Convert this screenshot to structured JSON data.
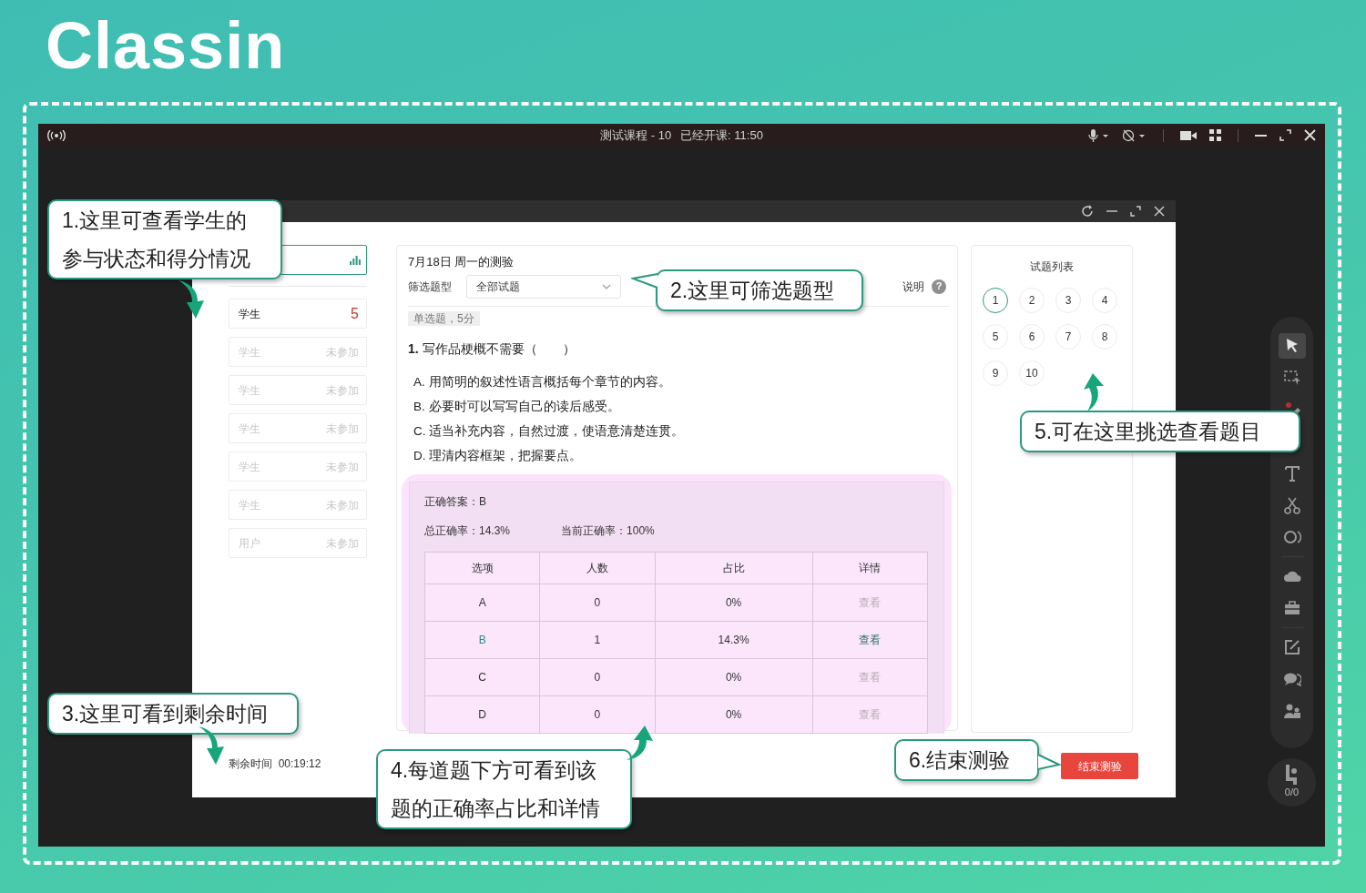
{
  "logo": "Classin",
  "window": {
    "title": "测试课程 - 10",
    "elapsed": "已经开课: 11:50"
  },
  "students": [
    {
      "name": "学生",
      "result": "5",
      "participated": true
    },
    {
      "name": "学生",
      "result": "未参加",
      "participated": false
    },
    {
      "name": "学生",
      "result": "未参加",
      "participated": false
    },
    {
      "name": "学生",
      "result": "未参加",
      "participated": false
    },
    {
      "name": "学生",
      "result": "未参加",
      "participated": false
    },
    {
      "name": "学生",
      "result": "未参加",
      "participated": false
    },
    {
      "name": "用户",
      "result": "未参加",
      "participated": false
    }
  ],
  "remaining_time": {
    "label": "剩余时间",
    "value": "00:19:12"
  },
  "quiz": {
    "title": "7月18日 周一的测验",
    "filter_label": "筛选题型",
    "filter_value": "全部试题",
    "help_label": "说明",
    "help_icon": "?",
    "question_type": "单选题，5分",
    "question": "**1.** 写作品梗概不需要（　　）",
    "options": [
      "A. 用简明的叙述性语言概括每个章节的内容。",
      "B. 必要时可以写写自己的读后感受。",
      "C. 适当补充内容，自然过渡，使语意清楚连贯。",
      "D. 理清内容框架，把握要点。"
    ],
    "correct_answer": "正确答案：B",
    "overall_rate": "总正确率：14.3%",
    "current_rate": "当前正确率：100%",
    "columns": [
      "选项",
      "人数",
      "占比",
      "详情"
    ],
    "rows": [
      {
        "option": "A",
        "count": "0",
        "share": "0%",
        "detail": "查看",
        "correct": false,
        "has_responses": false
      },
      {
        "option": "B",
        "count": "1",
        "share": "14.3%",
        "detail": "查看",
        "correct": true,
        "has_responses": true
      },
      {
        "option": "C",
        "count": "0",
        "share": "0%",
        "detail": "查看",
        "correct": false,
        "has_responses": false
      },
      {
        "option": "D",
        "count": "0",
        "share": "0%",
        "detail": "查看",
        "correct": false,
        "has_responses": false
      }
    ]
  },
  "question_list": {
    "title": "试题列表",
    "items": [
      {
        "label": "1",
        "selected": true
      },
      {
        "label": "2",
        "selected": false
      },
      {
        "label": "3",
        "selected": false
      },
      {
        "label": "4",
        "selected": false
      },
      {
        "label": "5",
        "selected": false
      },
      {
        "label": "6",
        "selected": false
      },
      {
        "label": "7",
        "selected": false
      },
      {
        "label": "8",
        "selected": false
      },
      {
        "label": "9",
        "selected": false
      },
      {
        "label": "10",
        "selected": false
      }
    ]
  },
  "end_button": "结束测验",
  "toolbar": [
    {
      "selected": true
    },
    {
      "selected": false
    },
    {
      "selected": false
    },
    {
      "selected": false
    },
    {
      "selected": false
    },
    {
      "selected": false
    },
    {
      "selected": false
    },
    {
      "selected": false
    },
    {
      "selected": false
    },
    {
      "selected": false
    },
    {
      "selected": false
    }
  ],
  "seat_counter": "0/0",
  "callouts": [
    {
      "lines": [
        "1.这里可查看学生的",
        "参与状态和得分情况"
      ]
    },
    {
      "lines": [
        "2.这里可筛选题型"
      ]
    },
    {
      "lines": [
        "3.这里可看到剩余时间"
      ]
    },
    {
      "lines": [
        "4.每道题下方可看到该",
        "题的正确率占比和详情"
      ]
    },
    {
      "lines": [
        "5.可在这里挑选查看题目"
      ]
    },
    {
      "lines": [
        "6.结束测验"
      ]
    }
  ]
}
